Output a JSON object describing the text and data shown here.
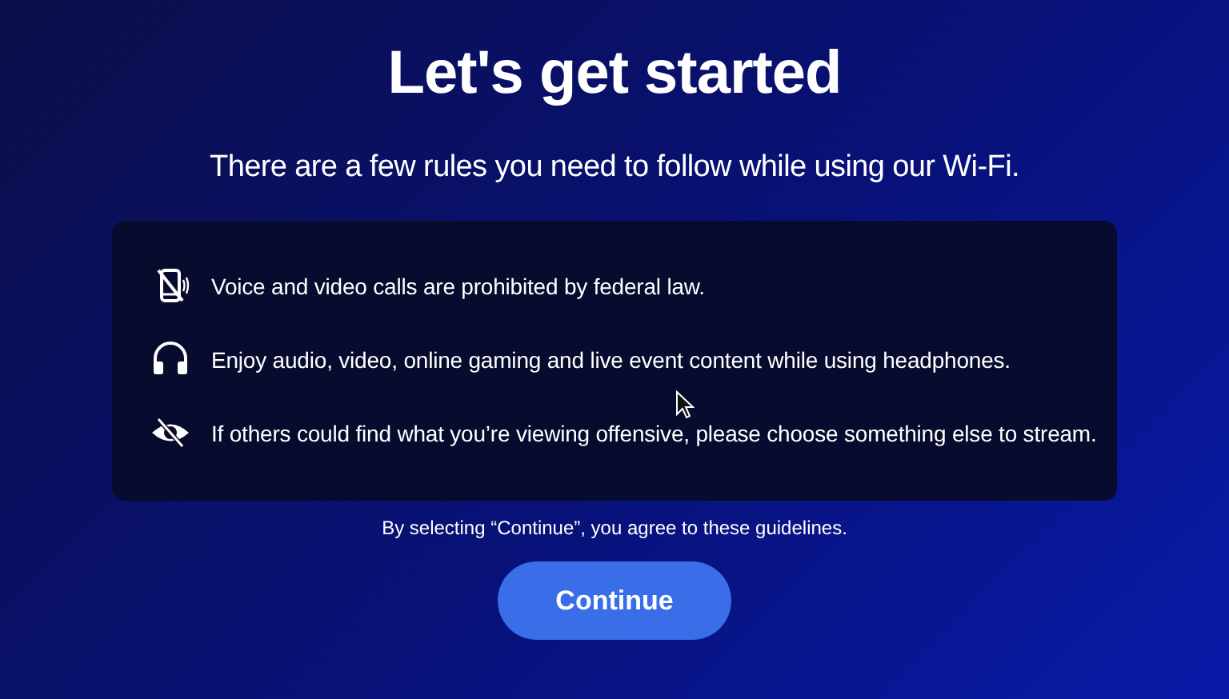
{
  "title": "Let's get started",
  "subtitle": "There are a few rules you need to follow while using our Wi-Fi.",
  "rules": [
    {
      "kind": "no-phone",
      "text": "Voice and video calls are prohibited by federal law."
    },
    {
      "kind": "headphones",
      "text": "Enjoy audio, video, online gaming and live event content while using headphones."
    },
    {
      "kind": "no-eye",
      "text": "If others could find what you’re viewing offensive, please choose something else to stream."
    }
  ],
  "agreement": "By selecting “Continue”, you agree to these guidelines.",
  "button": "Continue"
}
